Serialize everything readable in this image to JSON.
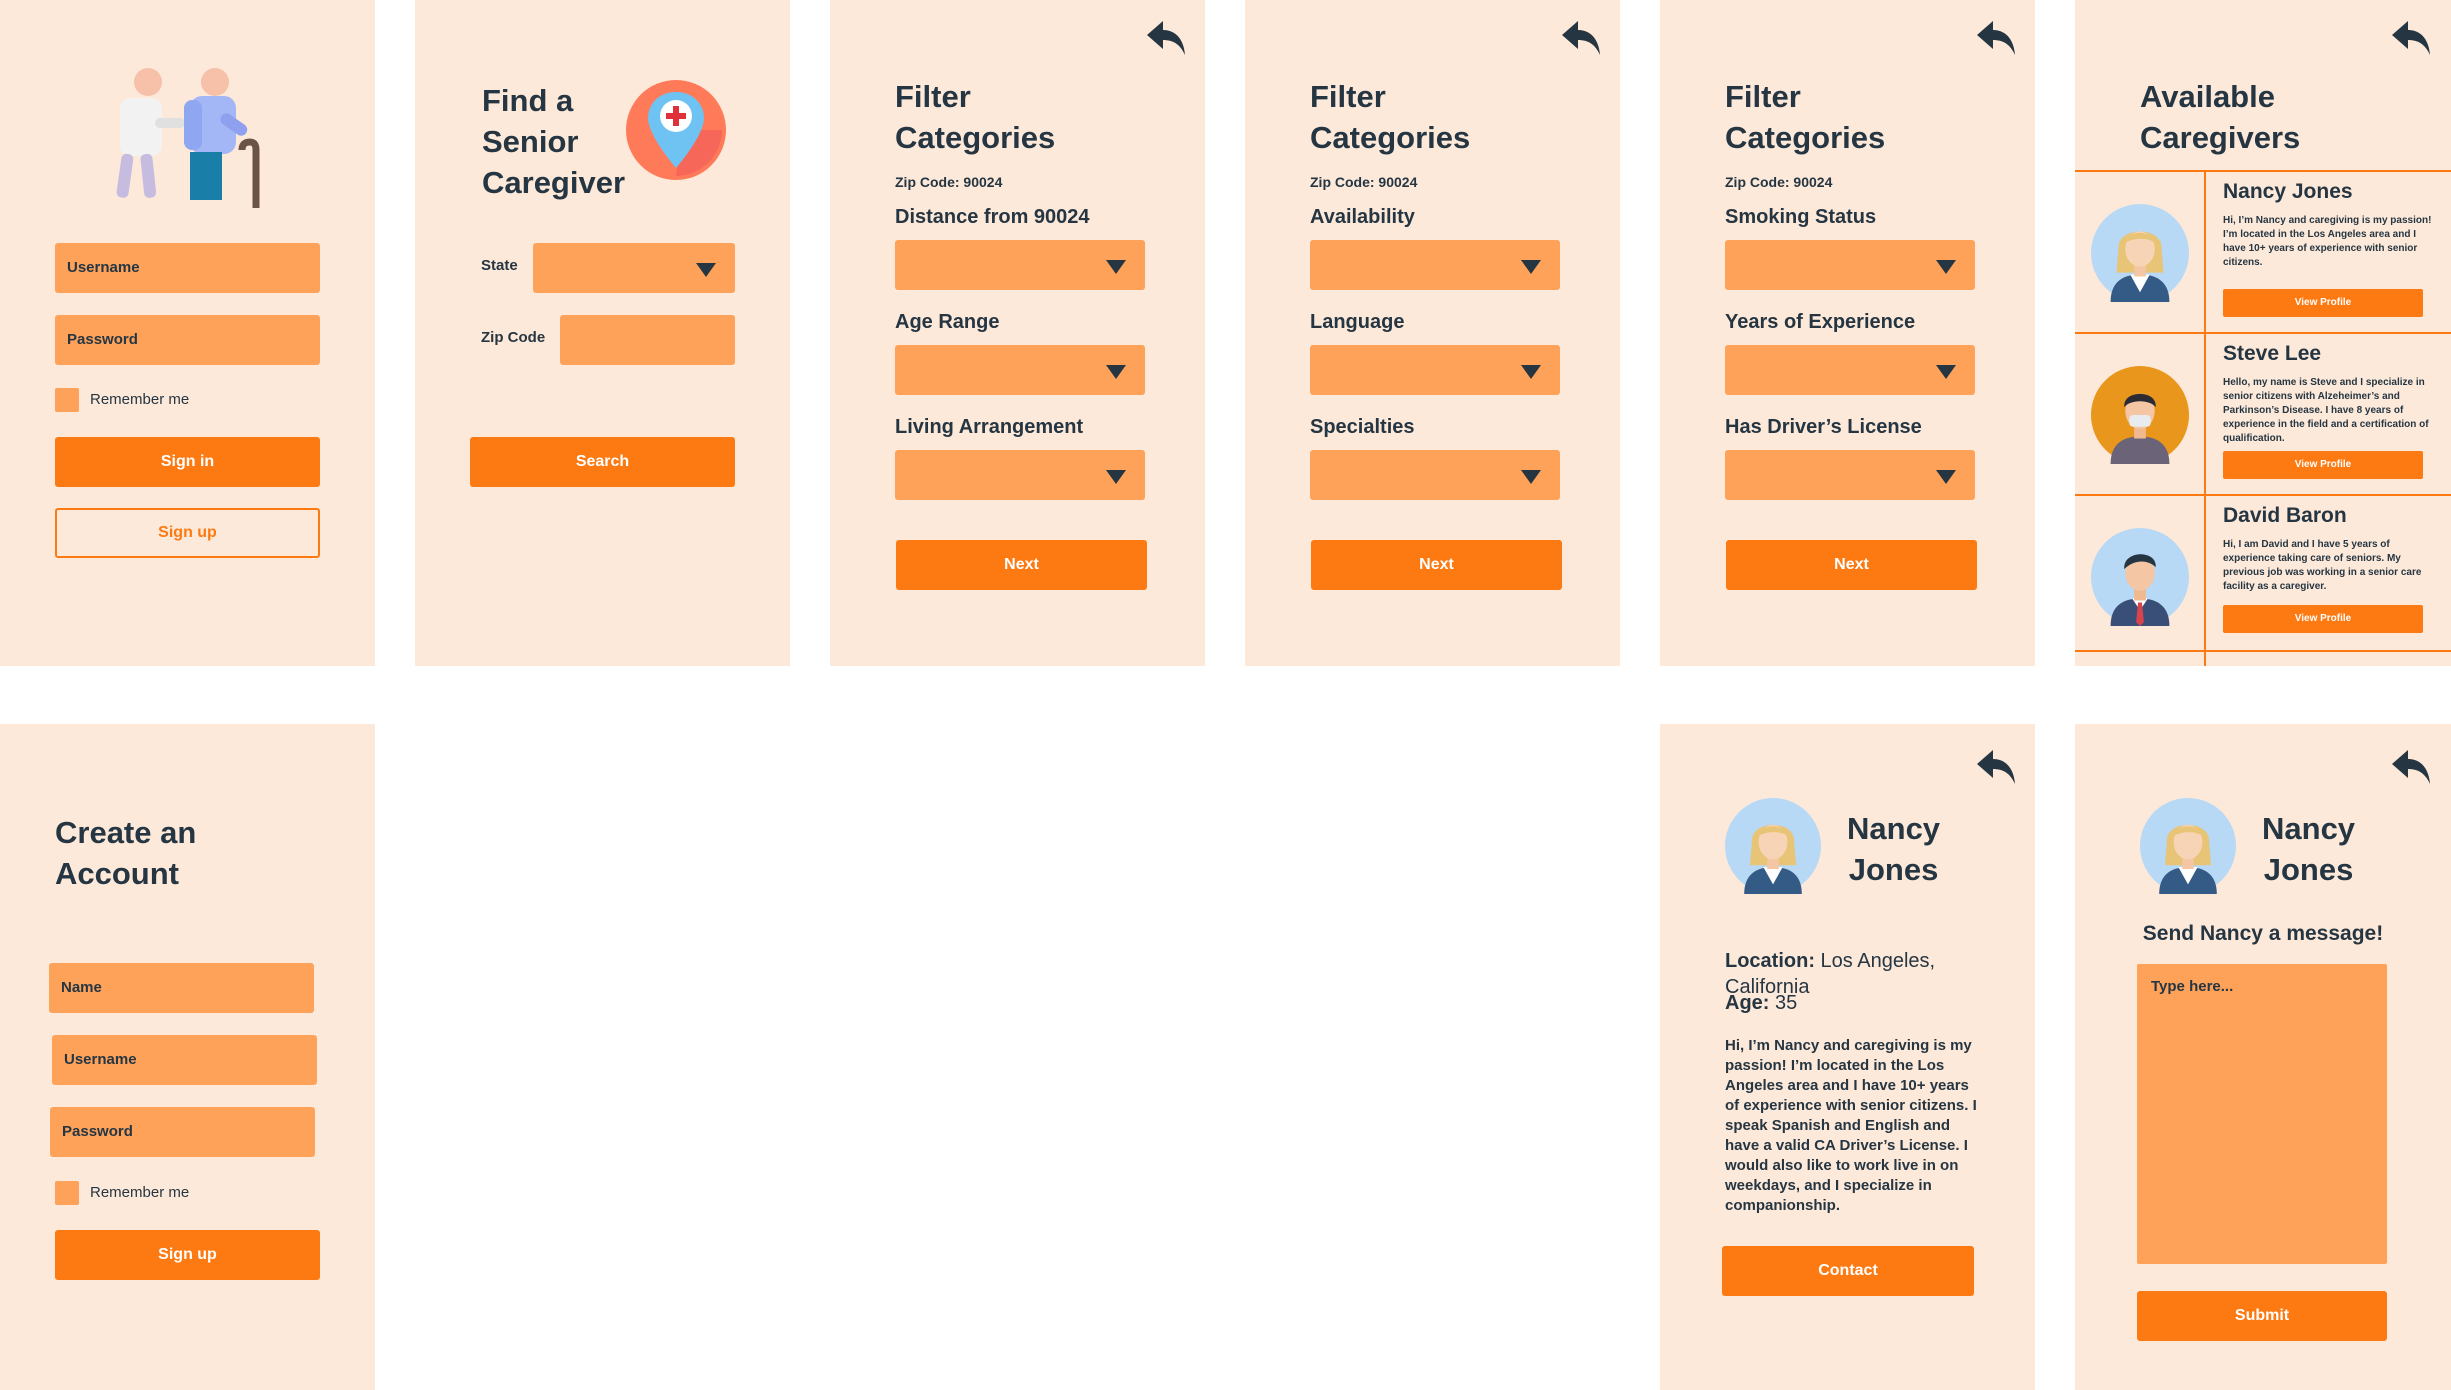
{
  "login": {
    "username_placeholder": "Username",
    "password_placeholder": "Password",
    "remember_label": "Remember me",
    "signin_label": "Sign in",
    "signup_label": "Sign up"
  },
  "find": {
    "title": "Find a\nSenior\nCaregiver",
    "state_label": "State",
    "zip_label": "Zip Code",
    "search_label": "Search"
  },
  "filter1": {
    "title": "Filter\nCategories",
    "zip": "Zip Code: 90024",
    "field1": "Distance from 90024",
    "field2": "Age Range",
    "field3": "Living Arrangement",
    "next_label": "Next"
  },
  "filter2": {
    "title": "Filter\nCategories",
    "zip": "Zip Code: 90024",
    "field1": "Availability",
    "field2": "Language",
    "field3": "Specialties",
    "next_label": "Next"
  },
  "filter3": {
    "title": "Filter\nCategories",
    "zip": "Zip Code: 90024",
    "field1": "Smoking Status",
    "field2": "Years of Experience",
    "field3": "Has Driver’s License",
    "next_label": "Next"
  },
  "available": {
    "title": "Available\nCaregivers",
    "view_profile_label": "View Profile",
    "caregivers": [
      {
        "name": "Nancy Jones",
        "bio": "Hi, I’m Nancy and caregiving is my passion! I’m located in the Los Angeles area and I have 10+ years of experience with senior citizens."
      },
      {
        "name": "Steve Lee",
        "bio": "Hello, my name is Steve and I specialize in senior citizens with Alzeheimer’s and Parkinson’s Disease. I have 8 years of experience in the field and a certification of qualification."
      },
      {
        "name": "David Baron",
        "bio": "Hi, I am David and I have 5 years of experience taking care of seniors. My previous job was working in a senior care facility as a caregiver."
      }
    ]
  },
  "create": {
    "title": "Create an\nAccount",
    "name_placeholder": "Name",
    "username_placeholder": "Username",
    "password_placeholder": "Password",
    "remember_label": "Remember me",
    "signup_label": "Sign up"
  },
  "profile": {
    "name": "Nancy\nJones",
    "location_label": "Location:",
    "location_value": " Los Angeles,\nCalifornia",
    "age_label": "Age:",
    "age_value": " 35",
    "bio": "Hi, I’m Nancy and caregiving is my passion! I’m located in the Los Angeles area and I have 10+ years of experience with senior citizens. I speak Spanish and English and have a valid CA Driver’s License. I would also like to work live in on weekdays, and I specialize in companionship.",
    "contact_label": "Contact"
  },
  "message": {
    "name": "Nancy\nJones",
    "heading": "Send Nancy a message!",
    "placeholder": "Type here...",
    "submit_label": "Submit"
  },
  "icons": {
    "back": "back-arrow-icon",
    "location": "location-pin-icon",
    "elderly": "elderly-couple-icon",
    "avatar": "avatar-icon"
  },
  "colors": {
    "panel_bg": "#fde9da",
    "field": "#fea25a",
    "button": "#fd7a12",
    "text": "#253642"
  }
}
